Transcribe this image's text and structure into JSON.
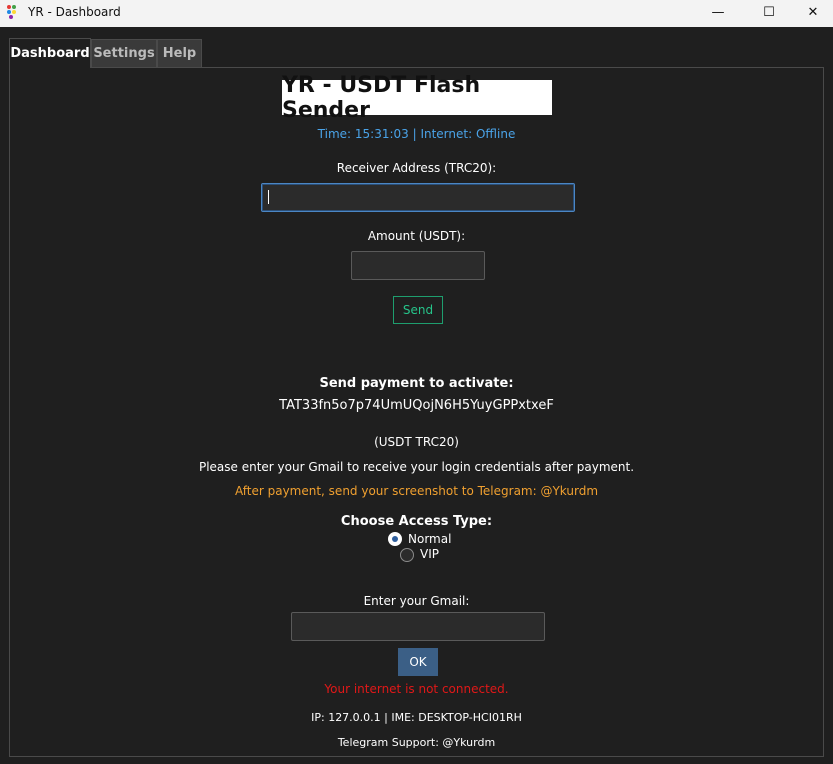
{
  "window": {
    "title": "YR - Dashboard",
    "minimize_glyph": "—",
    "maximize_glyph": "☐",
    "close_glyph": "✕"
  },
  "tabs": [
    {
      "label": "Dashboard",
      "active": true
    },
    {
      "label": "Settings",
      "active": false
    },
    {
      "label": "Help",
      "active": false
    }
  ],
  "main": {
    "heading": "YR - USDT Flash Sender",
    "status": "Time: 15:31:03 | Internet: Offline",
    "receiver_label": "Receiver Address (TRC20):",
    "receiver_value": "",
    "amount_label": "Amount (USDT):",
    "amount_value": "",
    "send_button": "Send"
  },
  "activation": {
    "title": "Send payment to activate:",
    "address": "TAT33fn5o7p74UmUQojN6H5YuyGPPxtxeF",
    "network": "(USDT TRC20)",
    "instructions": "Please enter your Gmail to receive your login credentials after payment.",
    "telegram_note": "After payment, send your screenshot to Telegram: @Ykurdm",
    "access_type_label": "Choose Access Type:",
    "options": [
      {
        "label": "Normal",
        "selected": true
      },
      {
        "label": "VIP",
        "selected": false
      }
    ],
    "gmail_label": "Enter your Gmail:",
    "gmail_value": "",
    "ok_button": "OK",
    "error_message": "Your internet is not connected."
  },
  "footer": {
    "ip_info": "IP: 127.0.0.1 | IME: DESKTOP-HCI01RH",
    "support": "Telegram Support: @Ykurdm"
  },
  "colors": {
    "background": "#1f1f1f",
    "status_blue": "#4aa3e8",
    "warning_orange": "#f0a030",
    "error_red": "#e01818",
    "send_green": "#26c48a",
    "ok_blue": "#3b5f86"
  }
}
